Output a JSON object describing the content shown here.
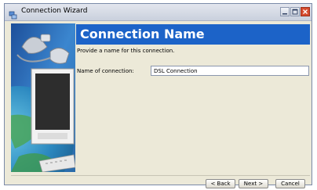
{
  "window": {
    "title": "Connection Wizard",
    "icon": "network-icon",
    "controls": [
      "minimize-icon",
      "maximize-icon",
      "close-icon"
    ]
  },
  "header": {
    "title": "Connection Name",
    "band_color": "#1c63c8"
  },
  "main": {
    "description": "Provide a name for this connection.",
    "name_field": {
      "label": "Name of connection:",
      "value": "DSL Connection"
    }
  },
  "footer": {
    "back_label": "< Back",
    "next_label": "Next >",
    "cancel_label": "Cancel"
  },
  "colors": {
    "accent": "#1c63c8",
    "window_bg": "#ece9d8",
    "close_button": "#d64b2e"
  }
}
